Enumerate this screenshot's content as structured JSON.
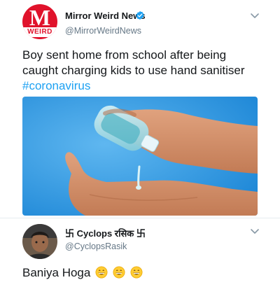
{
  "tweet": {
    "display_name": "Mirror Weird News",
    "handle": "@MirrorWeirdNews",
    "avatar_letter": "M",
    "avatar_subtext": "WEIRD",
    "text": "Boy sent home from school after being caught charging kids to use hand sanitiser",
    "hashtag": "#coronavirus",
    "verified": true,
    "media": {
      "icon": "hand-sanitiser-photo",
      "description_hidden": true
    }
  },
  "reply": {
    "display_name": "卐 Cyclops रसिक 卐",
    "handle": "@CyclopsRasik",
    "text": "Baniya Hoga",
    "emojis": [
      "grinning-face",
      "grinning-face",
      "grinning-face"
    ]
  },
  "colors": {
    "accent": "#1da1f2",
    "brand_red": "#e0122b",
    "muted": "#657786",
    "text": "#14171a"
  }
}
